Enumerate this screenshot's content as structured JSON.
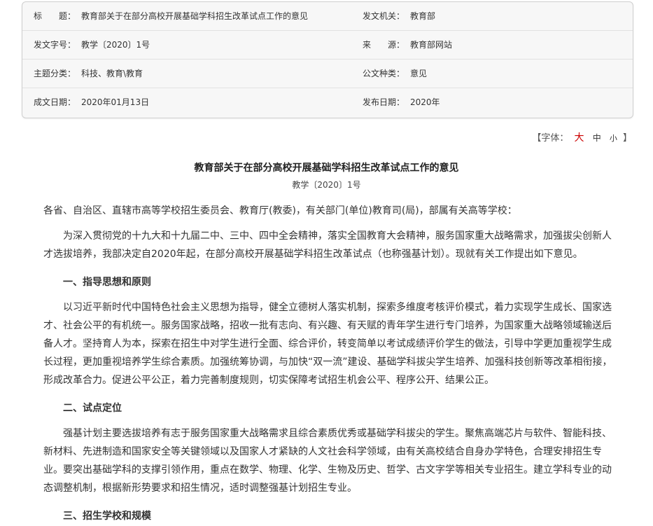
{
  "meta": {
    "rows": [
      [
        {
          "label": "标　　题：",
          "value": "教育部关于在部分高校开展基础学科招生改革试点工作的意见"
        },
        {
          "label": "发文机关：",
          "value": "教育部"
        }
      ],
      [
        {
          "label": "发文字号：",
          "value": "教学〔2020〕1号"
        },
        {
          "label": "来　　源：",
          "value": "教育部网站"
        }
      ],
      [
        {
          "label": "主题分类：",
          "value": "科技、教育\\教育"
        },
        {
          "label": "公文种类：",
          "value": "意见"
        }
      ],
      [
        {
          "label": "成文日期：",
          "value": "2020年01月13日"
        },
        {
          "label": "发布日期：",
          "value": "2020年"
        }
      ]
    ]
  },
  "font_control": {
    "open": "【字体：",
    "large": "大",
    "medium": "中",
    "small": "小",
    "close": "】"
  },
  "document": {
    "title": "教育部关于在部分高校开展基础学科招生改革试点工作的意见",
    "number": "教学〔2020〕1号",
    "salutation": "各省、自治区、直辖市高等学校招生委员会、教育厅(教委)，有关部门(单位)教育司(局)，部属有关高等学校：",
    "intro": "为深入贯彻党的十九大和十九届二中、三中、四中全会精神，落实全国教育大会精神，服务国家重大战略需求，加强拔尖创新人才选拔培养，我部决定自2020年起，在部分高校开展基础学科招生改革试点（也称强基计划）。现就有关工作提出如下意见。",
    "section1_heading": "一、指导思想和原则",
    "section1_body": "以习近平新时代中国特色社会主义思想为指导，健全立德树人落实机制，探索多维度考核评价模式，着力实现学生成长、国家选才、社会公平的有机统一。服务国家战略，招收一批有志向、有兴趣、有天赋的青年学生进行专门培养，为国家重大战略领域输送后备人才。坚持育人为本，探索在招生中对学生进行全面、综合评价，转变简单以考试成绩评价学生的做法，引导中学更加重视学生成长过程，更加重视培养学生综合素质。加强统筹协调，与加快“双一流”建设、基础学科拔尖学生培养、加强科技创新等改革相衔接，形成改革合力。促进公平公正，着力完善制度规则，切实保障考试招生机会公平、程序公开、结果公正。",
    "section2_heading": "二、试点定位",
    "section2_body": "强基计划主要选拔培养有志于服务国家重大战略需求且综合素质优秀或基础学科拔尖的学生。聚焦高端芯片与软件、智能科技、新材料、先进制造和国家安全等关键领域以及国家人才紧缺的人文社会科学领域，由有关高校结合自身办学特色，合理安排招生专业。要突出基础学科的支撑引领作用，重点在数学、物理、化学、生物及历史、哲学、古文字学等相关专业招生。建立学科专业的动态调整机制，根据新形势要求和招生情况，适时调整强基计划招生专业。",
    "section3_heading": "三、招生学校和规模"
  }
}
